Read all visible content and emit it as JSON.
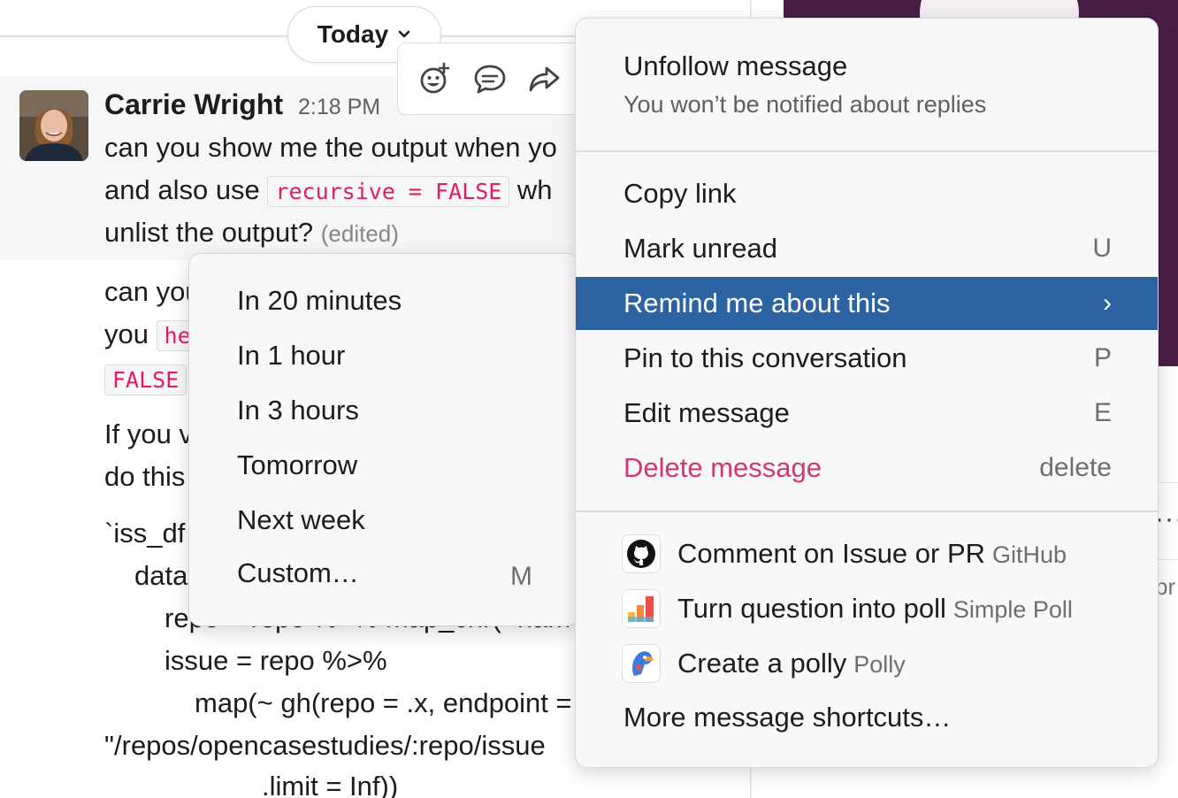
{
  "divider": {
    "today_label": "Today"
  },
  "message": {
    "author": "Carrie Wright",
    "timestamp": "2:18 PM",
    "line1": "can you show me the output when yo",
    "line2_pre": "and also  use ",
    "line2_code": "recursive = FALSE",
    "line2_post": " wh",
    "line3": "unlist the output?",
    "edited": "(edited)"
  },
  "message2": {
    "line1": "can you",
    "line2_pre": "you ",
    "line2_code": "he",
    "line3_code": "FALSE",
    "line4": "If you v",
    "line5": "do this",
    "code1": "`iss_df",
    "code2": "data",
    "code3": "repo = repo %>% map_chr(~nam",
    "code4": "issue = repo %>%",
    "code5": "map(~ gh(repo = .x, endpoint =",
    "code6": "\"/repos/opencasestudies/:repo/issue",
    "code7": ".limit = Inf))"
  },
  "toolbar": {
    "reaction_icon": "add-reaction-icon",
    "thread_icon": "reply-thread-icon",
    "share_icon": "share-forward-icon"
  },
  "context_menu": {
    "unfollow_title": "Unfollow message",
    "unfollow_subtitle": "You won’t be notified about replies",
    "items": [
      {
        "label": "Copy link",
        "key": ""
      },
      {
        "label": "Mark unread",
        "key": "U"
      },
      {
        "label": "Remind me about this",
        "key": "›"
      },
      {
        "label": "Pin to this conversation",
        "key": "P"
      },
      {
        "label": "Edit message",
        "key": "E"
      },
      {
        "label": "Delete message",
        "key": "delete"
      }
    ],
    "apps": [
      {
        "label": "Comment on Issue or PR",
        "source": "GitHub",
        "icon": "github-icon"
      },
      {
        "label": "Turn question into poll",
        "source": "Simple Poll",
        "icon": "simple-poll-icon"
      },
      {
        "label": "Create a polly",
        "source": "Polly",
        "icon": "polly-icon"
      }
    ],
    "more_shortcuts": "More message shortcuts…"
  },
  "remind_submenu": {
    "items": [
      {
        "label": "In 20 minutes",
        "key": ""
      },
      {
        "label": "In 1 hour",
        "key": ""
      },
      {
        "label": "In 3 hours",
        "key": ""
      },
      {
        "label": "Tomorrow",
        "key": ""
      },
      {
        "label": "Next week",
        "key": ""
      },
      {
        "label": "Custom…",
        "key": "M"
      }
    ]
  },
  "colors": {
    "highlight": "#2c64a3",
    "danger": "#d5376a",
    "code_text": "#e01e5a",
    "sidebar_purple": "#4a1d45"
  }
}
